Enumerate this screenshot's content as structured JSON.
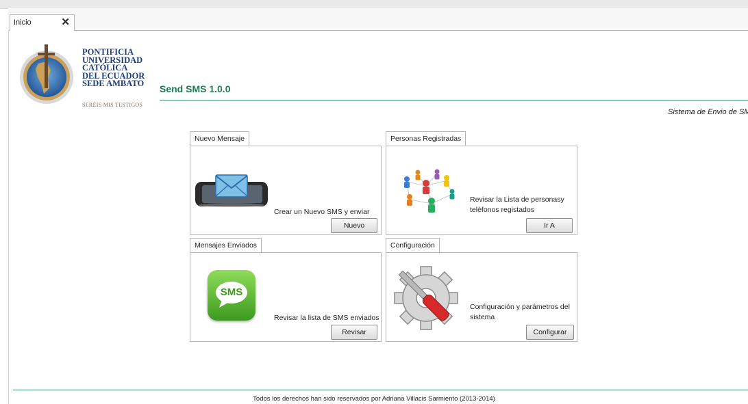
{
  "tabs": [
    {
      "label": "Inicio",
      "close": "✕"
    }
  ],
  "header": {
    "university_lines": [
      "PONTIFICIA",
      "UNIVERSIDAD",
      "CATÓLICA",
      "DEL ECUADOR",
      "SEDE AMBATO"
    ],
    "motto": "SERÉIS MIS TESTIGOS",
    "app_title": "Send SMS 1.0.0",
    "subtitle": "Sistema de Envio de SM"
  },
  "panels": {
    "nuevo": {
      "tab": "Nuevo Mensaje",
      "description": "Crear un Nuevo SMS  y enviar",
      "button": "Nuevo",
      "icon": "phone-envelope-icon"
    },
    "personas": {
      "tab": "Personas Registradas",
      "description": "Revisar la Lista de personasy teléfonos  registados",
      "button": "Ir A",
      "icon": "people-network-icon"
    },
    "enviados": {
      "tab": "Mensajes Enviados",
      "description": "Revisar la lista de SMS enviados",
      "button": "Revisar",
      "icon": "sms-bubble-icon",
      "icon_text": "SMS"
    },
    "config": {
      "tab": "Configuración",
      "description": "Configuración y parámetros del sistema",
      "button": "Configurar",
      "icon": "gear-screwdriver-icon"
    }
  },
  "footer": "Todos los derechos han sido reservados por Adriana Villacis Sarmiento (2013-2014)",
  "colors": {
    "accent": "#1e7a50",
    "university_blue": "#1d3e7a"
  }
}
